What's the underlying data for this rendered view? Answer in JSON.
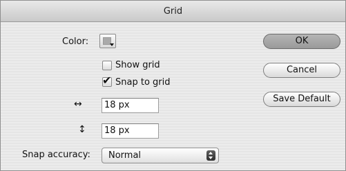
{
  "window": {
    "title": "Grid"
  },
  "color": {
    "label": "Color:",
    "swatch": "#aaaaaa"
  },
  "show_grid": {
    "label": "Show grid",
    "checked": false
  },
  "snap_to_grid": {
    "label": "Snap to grid",
    "checked": true
  },
  "horizontal": {
    "icon": "horizontal-arrow-icon",
    "glyph": "↔",
    "value": "18 px"
  },
  "vertical": {
    "icon": "vertical-arrow-icon",
    "glyph": "↕",
    "value": "18 px"
  },
  "snap_accuracy": {
    "label": "Snap accuracy:",
    "value": "Normal"
  },
  "buttons": {
    "ok": "OK",
    "cancel": "Cancel",
    "save_default": "Save Default"
  }
}
